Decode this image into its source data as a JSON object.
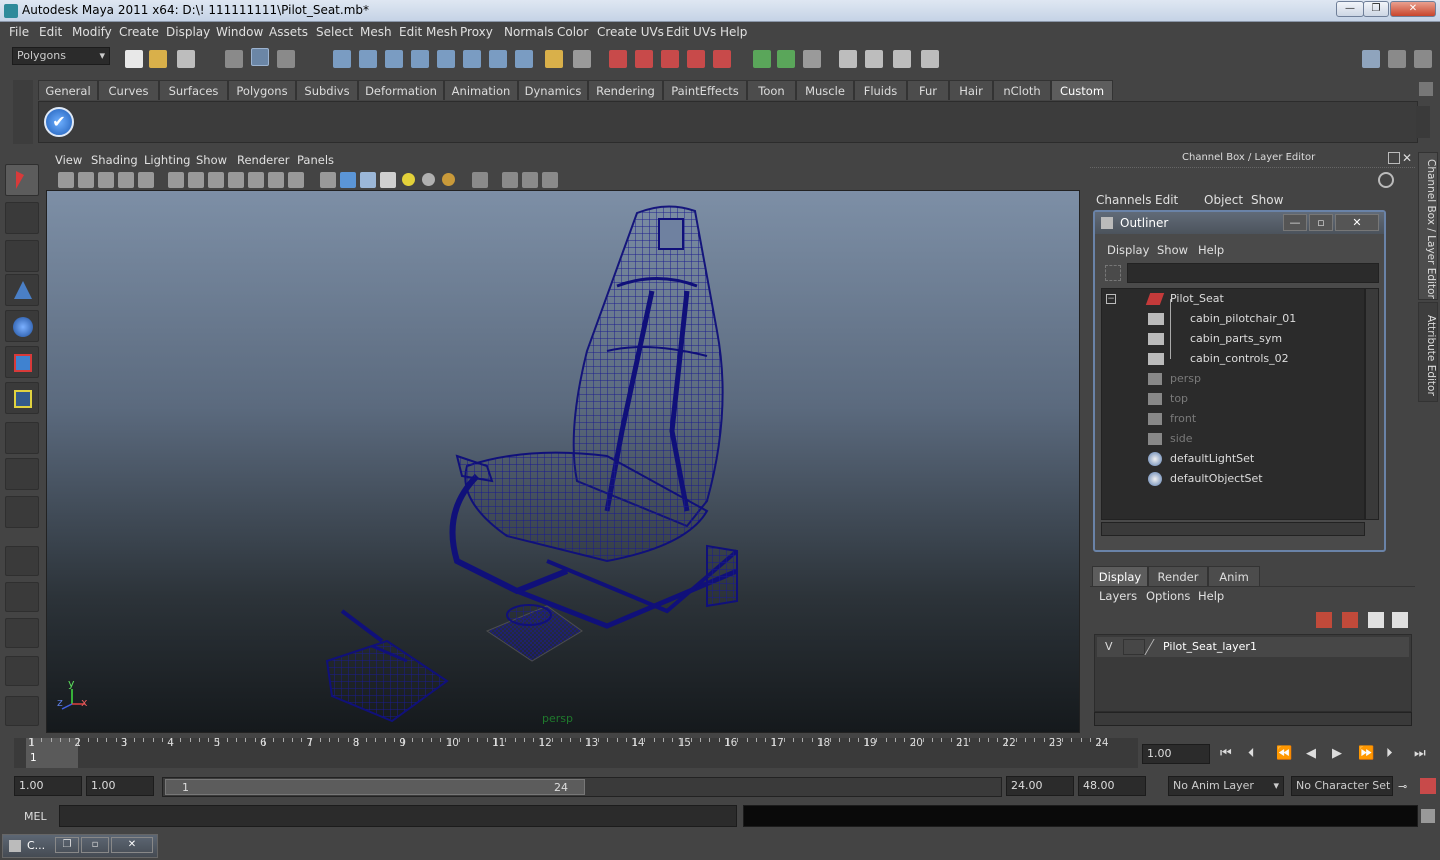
{
  "window": {
    "title": "Autodesk Maya 2011 x64: D:\\! 111111111\\Pilot_Seat.mb*",
    "minimize": "—",
    "maximize": "❐",
    "close": "✕"
  },
  "menubar": [
    "File",
    "Edit",
    "Modify",
    "Create",
    "Display",
    "Window",
    "Assets",
    "Select",
    "Mesh",
    "Edit Mesh",
    "Proxy",
    "Normals",
    "Color",
    "Create UVs",
    "Edit UVs",
    "Help"
  ],
  "statusline": {
    "menuset": "Polygons"
  },
  "shelf": {
    "tabs": [
      "General",
      "Curves",
      "Surfaces",
      "Polygons",
      "Subdivs",
      "Deformation",
      "Animation",
      "Dynamics",
      "Rendering",
      "PaintEffects",
      "Toon",
      "Muscle",
      "Fluids",
      "Fur",
      "Hair",
      "nCloth",
      "Custom"
    ],
    "active_tab": "Custom"
  },
  "viewport": {
    "menu": [
      "View",
      "Shading",
      "Lighting",
      "Show",
      "Renderer",
      "Panels"
    ],
    "camera_label": "persp",
    "axis_x": "x",
    "axis_y": "y",
    "axis_z": "z",
    "colors": {
      "wireframe": "#1a1a8c"
    }
  },
  "channelbox": {
    "title": "Channel Box / Layer Editor",
    "menu": [
      "Channels",
      "Edit",
      "Object",
      "Show"
    ],
    "side_tab_1": "Channel Box / Layer Editor",
    "side_tab_2": "Attribute Editor"
  },
  "outliner": {
    "title": "Outliner",
    "menu": [
      "Display",
      "Show",
      "Help"
    ],
    "items": [
      {
        "label": "Pilot_Seat",
        "icon": "transform-icon",
        "dim": false
      },
      {
        "label": "cabin_pilotchair_01",
        "icon": "mesh-icon",
        "dim": false
      },
      {
        "label": "cabin_parts_sym",
        "icon": "mesh-icon",
        "dim": false
      },
      {
        "label": "cabin_controls_02",
        "icon": "mesh-icon",
        "dim": false
      },
      {
        "label": "persp",
        "icon": "camera-icon",
        "dim": true
      },
      {
        "label": "top",
        "icon": "camera-icon",
        "dim": true
      },
      {
        "label": "front",
        "icon": "camera-icon",
        "dim": true
      },
      {
        "label": "side",
        "icon": "camera-icon",
        "dim": true
      },
      {
        "label": "defaultLightSet",
        "icon": "set-icon",
        "dim": false
      },
      {
        "label": "defaultObjectSet",
        "icon": "set-icon",
        "dim": false
      }
    ]
  },
  "layer_editor": {
    "tabs": [
      "Display",
      "Render",
      "Anim"
    ],
    "active_tab": "Display",
    "menu": [
      "Layers",
      "Options",
      "Help"
    ],
    "layer": {
      "visible": "V",
      "name": "Pilot_Seat_layer1"
    }
  },
  "timeline": {
    "ticks": [
      "1",
      "2",
      "3",
      "4",
      "5",
      "6",
      "7",
      "8",
      "9",
      "10",
      "11",
      "12",
      "13",
      "14",
      "15",
      "16",
      "17",
      "18",
      "19",
      "20",
      "21",
      "22",
      "23",
      "24"
    ],
    "current_frame_marker": "1",
    "current_time": "1.00"
  },
  "range": {
    "start_time": "1.00",
    "playback_start": "1.00",
    "slider_start": "1",
    "slider_end": "24",
    "playback_end": "24.00",
    "end_time": "48.00",
    "anim_layer": "No Anim Layer",
    "character_set": "No Character Set"
  },
  "command_line": {
    "label": "MEL"
  },
  "taskbar": {
    "item": "C..."
  }
}
